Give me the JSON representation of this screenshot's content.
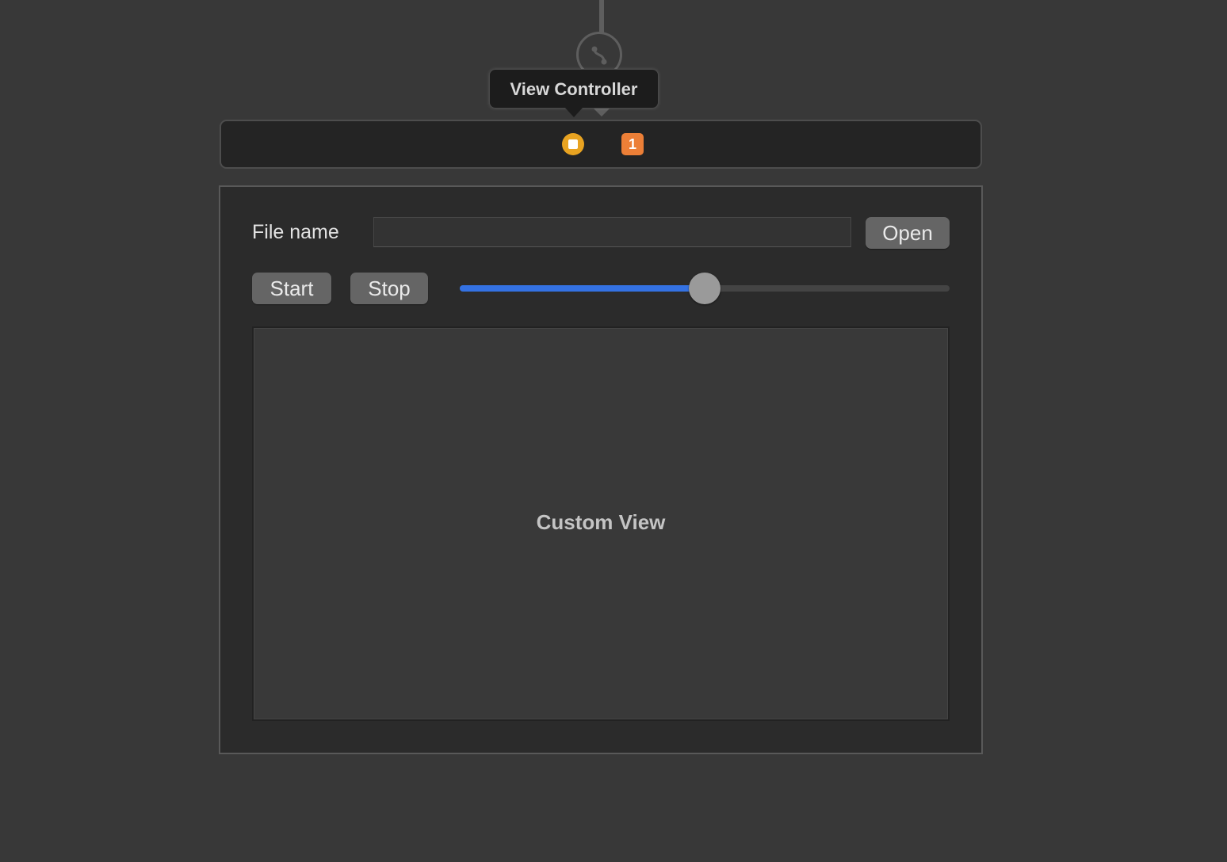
{
  "scene": {
    "tooltip": "View Controller",
    "icons": {
      "segue": "segue-icon",
      "view_controller": "view-controller-icon"
    },
    "badge_count": "1",
    "colors": {
      "view_controller_icon": "#e8a321",
      "badge": "#ec7f37",
      "slider_fill": "#3472e3"
    }
  },
  "form": {
    "file_label": "File name",
    "file_value": "",
    "file_placeholder": "",
    "open_label": "Open",
    "start_label": "Start",
    "stop_label": "Stop",
    "slider_value": 0.5
  },
  "custom_view": {
    "label": "Custom View"
  }
}
